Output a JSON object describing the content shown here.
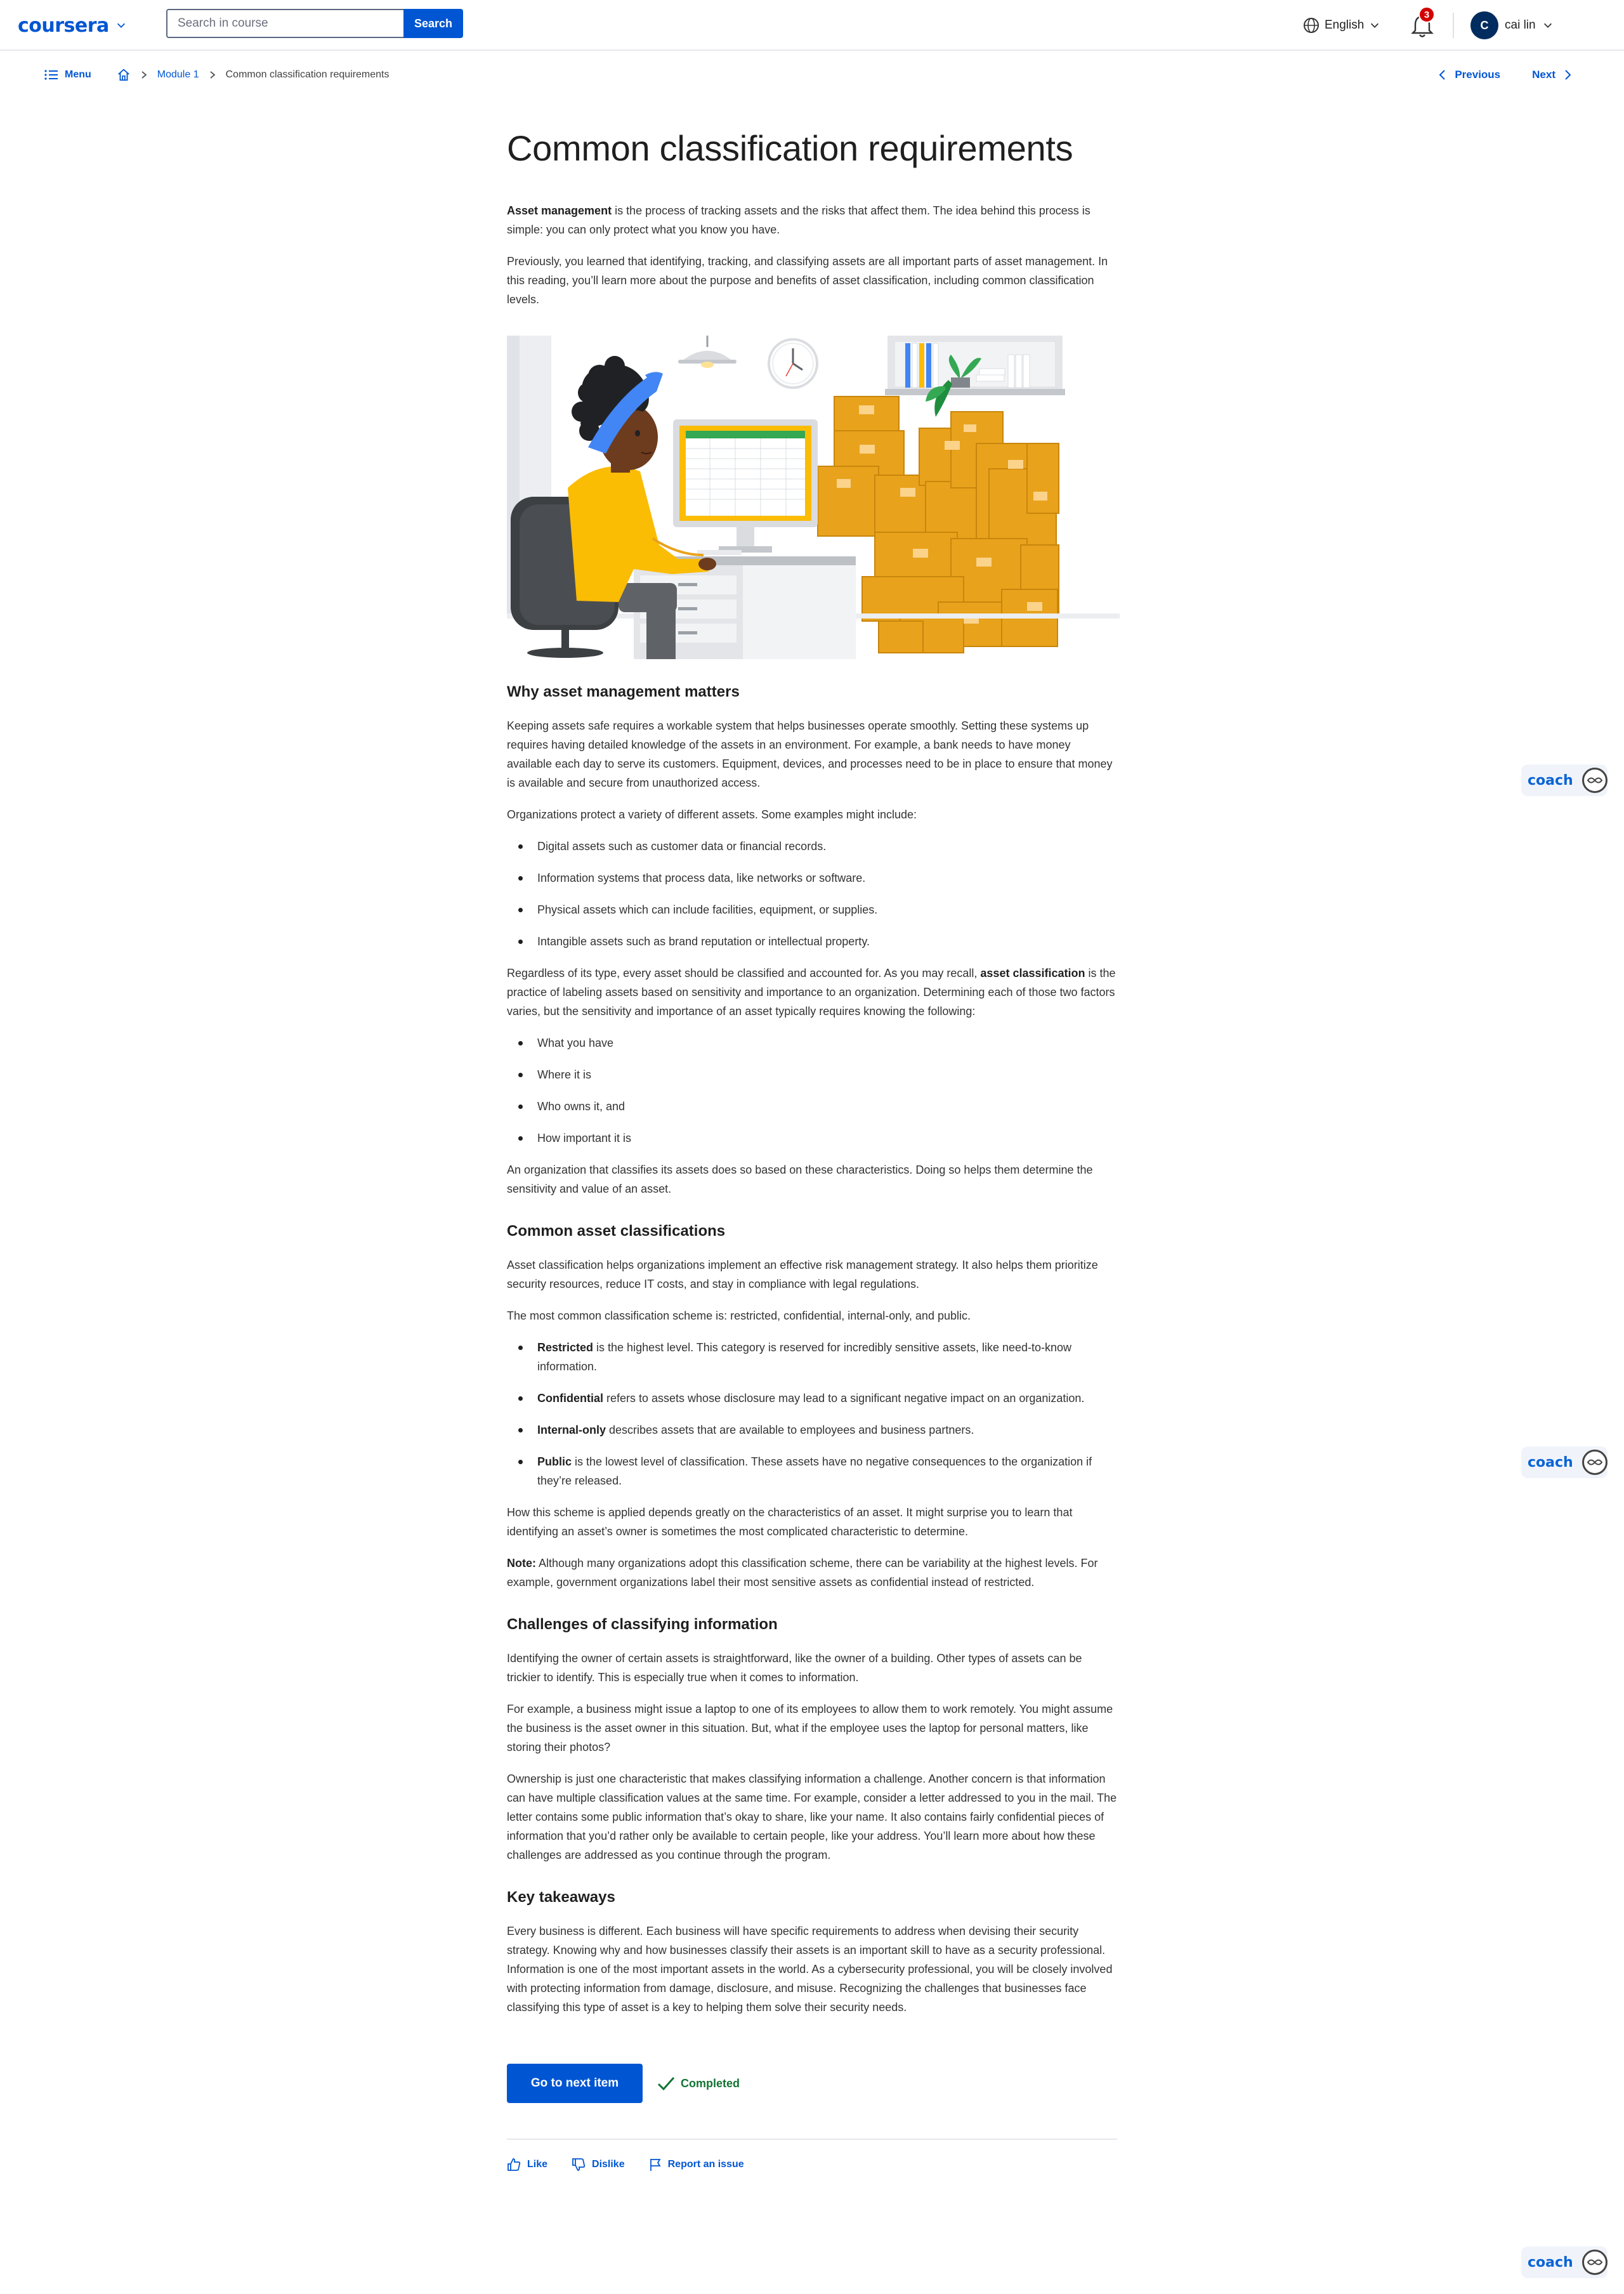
{
  "header": {
    "logo": "coursera",
    "search_placeholder": "Search in course",
    "search_button": "Search",
    "language": "English",
    "notifications_count": "3",
    "user_initial": "C",
    "user_name": "cai lin"
  },
  "breadcrumb": {
    "menu": "Menu",
    "module": "Module 1",
    "current": "Common classification requirements",
    "previous": "Previous",
    "next": "Next"
  },
  "article": {
    "title": "Common classification requirements",
    "intro_bold": "Asset management",
    "intro_rest": " is the process of tracking assets and the risks that affect them. The idea behind this process is simple: you can only protect what you know you have.",
    "intro_p2": "Previously, you learned that identifying, tracking, and classifying assets are all important parts of asset management. In this reading, you’ll learn more about the purpose and benefits of asset classification, including common classification levels.",
    "s1_heading": "Why asset management matters",
    "s1_p1": "Keeping assets safe requires a workable system that helps businesses operate smoothly. Setting these systems up requires having detailed knowledge of the assets in an environment. For example, a bank needs to have money available each day to serve its customers. Equipment, devices, and processes need to be in place to ensure that money is available and secure from unauthorized access.",
    "s1_p2": "Organizations protect a variety of different assets. Some examples might include:",
    "s1_list": [
      "Digital assets such as customer data or financial records.",
      "Information systems that process data, like networks or software.",
      "Physical assets which can include facilities, equipment, or supplies.",
      "Intangible assets such as brand reputation or intellectual property."
    ],
    "s1_p3_a": "Regardless of its type, every asset should be classified and accounted for. As you may recall, ",
    "s1_p3_bold": "asset classification",
    "s1_p3_b": " is the practice of labeling assets based on sensitivity and importance to an organization. Determining each of those two factors varies, but the sensitivity and importance of an asset typically requires knowing the following:",
    "s1_list2": [
      "What you have",
      "Where it is",
      "Who owns it, and",
      "How important it is"
    ],
    "s1_p4": "An organization that classifies its assets does so based on these characteristics. Doing so helps them determine the sensitivity and value of an asset.",
    "s2_heading": "Common asset classifications",
    "s2_p1": "Asset classification helps organizations implement an effective risk management strategy. It also helps them prioritize security resources, reduce IT costs, and stay in compliance with legal regulations.",
    "s2_p2": "The most common classification scheme is: restricted, confidential, internal-only, and public.",
    "s2_list": [
      {
        "bold": "Restricted",
        "text": " is the highest level. This category is reserved for incredibly sensitive assets,  like need-to-know information."
      },
      {
        "bold": "Confidential",
        "text": " refers to assets whose disclosure may lead to a significant negative impact on an organization."
      },
      {
        "bold": "Internal-only",
        "text": " describes assets that are available to employees and business partners."
      },
      {
        "bold": "Public",
        "text": " is the lowest level of classification. These assets have no negative consequences to the organization if they’re released."
      }
    ],
    "s2_p3": "How this scheme is applied depends greatly on the characteristics of an asset. It might surprise you to learn that identifying an asset’s owner is sometimes the most complicated characteristic to determine.",
    "s2_note_bold": "Note:",
    "s2_note": " Although many organizations adopt this classification scheme, there can be variability at the highest levels. For example, government organizations label their most sensitive assets as confidential instead of restricted.",
    "s3_heading": "Challenges of classifying information",
    "s3_p1": "Identifying the owner of certain assets is straightforward, like the owner of a building. Other types of assets can be trickier to identify. This is especially true when it comes to information.",
    "s3_p2": "For example, a business might issue a laptop to one of its employees to allow them to work remotely. You might assume the business is the asset owner in this situation. But, what if the employee uses the laptop for personal matters, like storing their photos?",
    "s3_p3": "Ownership is just one characteristic that makes classifying information a challenge. Another concern is that information can have multiple classification values at the same time. For example, consider a letter addressed to you in the mail. The letter contains some public information that’s okay to share, like your name. It also contains fairly confidential pieces of information that you’d rather only be available to certain people, like your address. You’ll learn more about how these challenges are addressed as you continue through the program.",
    "s4_heading": "Key takeaways",
    "s4_p1": "Every business is different. Each business will have specific requirements to address when devising their security strategy. Knowing why and how businesses classify their assets is an important skill to have as a security professional. Information is one of the most important assets in the world. As a cybersecurity professional, you will be closely involved with protecting information from damage, disclosure, and misuse. Recognizing the challenges that businesses face classifying this type of asset is a key to helping them solve their security needs."
  },
  "footer": {
    "next_item": "Go to next item",
    "completed": "Completed",
    "like": "Like",
    "dislike": "Dislike",
    "report": "Report an issue"
  },
  "coach": {
    "label": "coach"
  },
  "colors": {
    "brand": "#0056d2",
    "completed": "#137333",
    "badge": "#d30001",
    "box_orange": "#e8a21c"
  }
}
